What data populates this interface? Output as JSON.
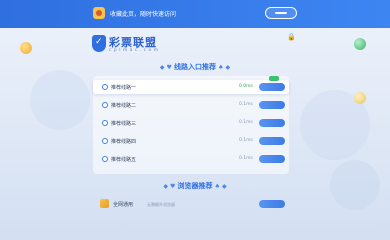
{
  "topbar": {
    "tip": "收藏此页，随时快速访问"
  },
  "logo": {
    "name": "彩票联盟",
    "domain": "c p l m a c . c o m"
  },
  "lines_section": {
    "title": "线路入口推荐"
  },
  "lines": [
    {
      "label": "推荐线路一",
      "ms": "0.0ms"
    },
    {
      "label": "推荐线路二",
      "ms": "0.1ms"
    },
    {
      "label": "推荐线路三",
      "ms": "0.1ms"
    },
    {
      "label": "推荐线路四",
      "ms": "0.1ms"
    },
    {
      "label": "推荐线路五",
      "ms": "0.1ms"
    }
  ],
  "browser_section": {
    "title": "浏览器推荐"
  },
  "browser": {
    "name": "全网通用",
    "desc": "无需额外浏览器"
  },
  "colors": {
    "primary": "#2f6fe0",
    "accent_green": "#36c46c",
    "background": "#e4ecf8"
  },
  "icons": {
    "app": "app-icon",
    "shield": "shield-logo-icon",
    "browser": "browser-icon"
  }
}
